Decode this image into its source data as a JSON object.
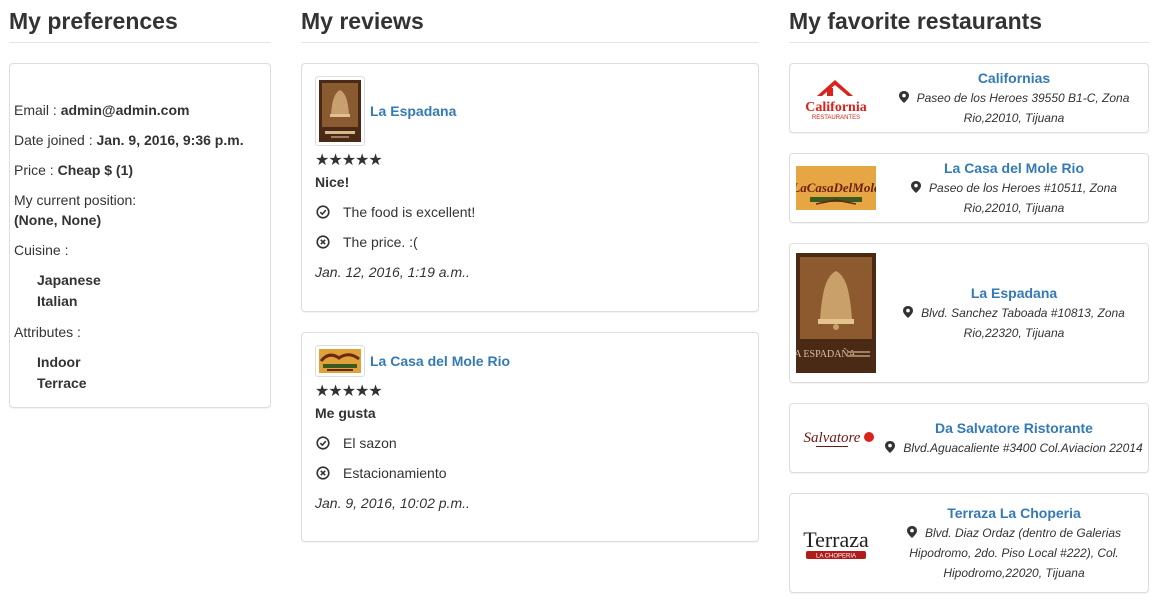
{
  "preferences": {
    "heading": "My preferences",
    "email_label": "Email : ",
    "email": "admin@admin.com",
    "joined_label": "Date joined : ",
    "joined": "Jan. 9, 2016, 9:36 p.m.",
    "price_label": "Price : ",
    "price": "Cheap $ (1)",
    "position_label": "My current position:",
    "position": "(None, None)",
    "cuisine_label": "Cuisine :",
    "cuisines": [
      "Japanese",
      "Italian"
    ],
    "attributes_label": "Attributes :",
    "attributes": [
      "Indoor",
      "Terrace"
    ]
  },
  "reviews": {
    "heading": "My reviews",
    "items": [
      {
        "restaurant": "La Espadana",
        "stars": "★★★★★",
        "title": "Nice!",
        "positive": "The food is excellent!",
        "negative": "The price. :(",
        "date": "Jan. 12, 2016, 1:19 a.m.."
      },
      {
        "restaurant": "La Casa del Mole Rio",
        "stars": "★★★★★",
        "title": "Me gusta",
        "positive": "El sazon",
        "negative": "Estacionamiento",
        "date": "Jan. 9, 2016, 10:02 p.m.."
      }
    ]
  },
  "favorites": {
    "heading": "My favorite restaurants",
    "items": [
      {
        "name": "Californias",
        "address": "Paseo de los Heroes 39550 B1-C, Zona Rio,22010, Tijuana",
        "logo_text": "California",
        "logo_sub": "RESTAURANTES"
      },
      {
        "name": "La Casa del Mole Rio",
        "address": "Paseo de los Heroes #10511, Zona Rio,22010, Tijuana",
        "logo_text": "LaCasaDelMole"
      },
      {
        "name": "La Espadana",
        "address": "Blvd. Sanchez Taboada #10813, Zona Rio,22320, Tijuana",
        "logo_text": "LA ESPADAÑA"
      },
      {
        "name": "Da Salvatore Ristorante",
        "address": "Blvd.Aguacaliente #3400 Col.Aviacion 22014",
        "logo_text": "Salvatore"
      },
      {
        "name": "Terraza La Choperia",
        "address": "Blvd. Diaz Ordaz (dentro de Galerias Hipodromo, 2do. Piso Local #222), Col. Hipodromo,22020, Tijuana",
        "logo_text": "Terraza",
        "logo_sub": "LA CHOPERIA"
      }
    ]
  },
  "colors": {
    "link": "#337ab7",
    "border": "#dddddd",
    "text": "#333333"
  }
}
